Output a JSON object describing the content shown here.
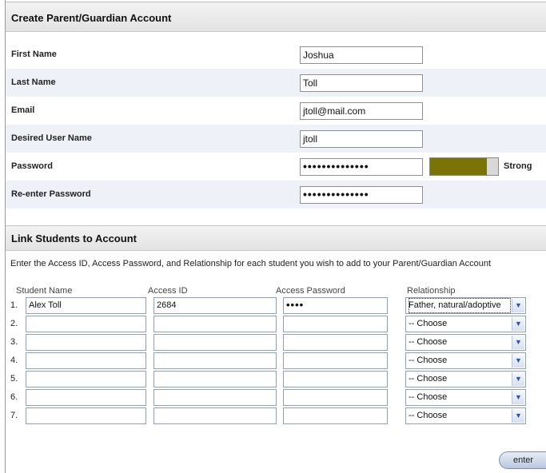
{
  "account": {
    "title": "Create Parent/Guardian Account",
    "fields": [
      {
        "label": "First Name",
        "value": "Joshua"
      },
      {
        "label": "Last Name",
        "value": "Toll"
      },
      {
        "label": "Email",
        "value": "jtoll@mail.com"
      },
      {
        "label": "Desired User Name",
        "value": "jtoll"
      },
      {
        "label": "Password",
        "value": "••••••••••••••"
      },
      {
        "label": "Re-enter Password",
        "value": "••••••••••••••"
      }
    ],
    "strength": {
      "label": "Strong",
      "fraction": 0.83,
      "color": "#7a7306"
    }
  },
  "students": {
    "title": "Link Students to Account",
    "instructions": "Enter the Access ID, Access Password, and Relationship for each student you wish to add to your Parent/Guardian Account",
    "columns": [
      "Student Name",
      "Access ID",
      "Access Password",
      "Relationship"
    ],
    "rows": [
      {
        "num": "1.",
        "name": "Alex Toll",
        "access_id": "2684",
        "password": "••••",
        "relationship": "Father, natural/adoptive"
      },
      {
        "num": "2.",
        "name": "",
        "access_id": "",
        "password": "",
        "relationship": "-- Choose"
      },
      {
        "num": "3.",
        "name": "",
        "access_id": "",
        "password": "",
        "relationship": "-- Choose"
      },
      {
        "num": "4.",
        "name": "",
        "access_id": "",
        "password": "",
        "relationship": "-- Choose"
      },
      {
        "num": "5.",
        "name": "",
        "access_id": "",
        "password": "",
        "relationship": "-- Choose"
      },
      {
        "num": "6.",
        "name": "",
        "access_id": "",
        "password": "",
        "relationship": "-- Choose"
      },
      {
        "num": "7.",
        "name": "",
        "access_id": "",
        "password": "",
        "relationship": "-- Choose"
      }
    ]
  },
  "enter_label": "enter",
  "icons": {
    "dropdown": "chevron-down-icon"
  }
}
